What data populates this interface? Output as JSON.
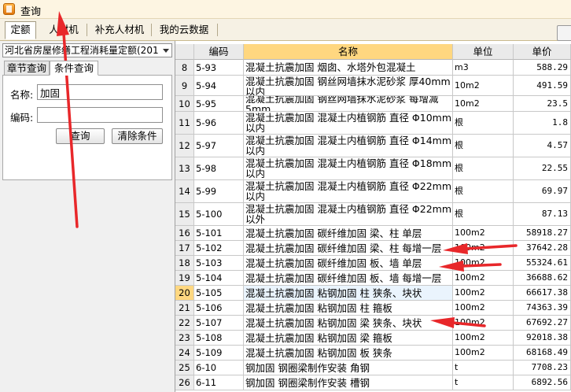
{
  "window": {
    "title": "查询"
  },
  "tabs": [
    {
      "label": "定额",
      "active": true
    },
    {
      "label": "人材机"
    },
    {
      "label": "补充人材机"
    },
    {
      "label": "我的云数据"
    }
  ],
  "left": {
    "quota_library": "河北省房屋修缮工程消耗量定额(201",
    "subtabs": [
      {
        "label": "章节查询"
      },
      {
        "label": "条件查询",
        "active": true
      }
    ],
    "form": {
      "name_label": "名称:",
      "name_value": "加固",
      "code_label": "编码:",
      "code_value": "",
      "search_button": "查询",
      "clear_button": "清除条件"
    }
  },
  "table": {
    "headers": [
      "",
      "编码",
      "名称",
      "单位",
      "单价"
    ],
    "rows": [
      {
        "idx": "8",
        "code": "5-93",
        "name": "混凝土抗震加固 烟囱、水塔外包混凝土",
        "unit": "m3",
        "price": "588.29"
      },
      {
        "idx": "9",
        "code": "5-94",
        "name": "混凝土抗震加固 钢丝网墙抹水泥砂浆 厚40mm以内",
        "unit": "10m2",
        "price": "491.59"
      },
      {
        "idx": "10",
        "code": "5-95",
        "name": "混凝土抗震加固 钢丝网墙抹水泥砂浆 每增减5mm",
        "unit": "10m2",
        "price": "23.5"
      },
      {
        "idx": "11",
        "code": "5-96",
        "name": "混凝土抗震加固 混凝土内植钢筋 直径 Φ10mm以内",
        "unit": "根",
        "price": "1.8"
      },
      {
        "idx": "12",
        "code": "5-97",
        "name": "混凝土抗震加固 混凝土内植钢筋 直径 Φ14mm以内",
        "unit": "根",
        "price": "4.57"
      },
      {
        "idx": "13",
        "code": "5-98",
        "name": "混凝土抗震加固 混凝土内植钢筋 直径 Φ18mm以内",
        "unit": "根",
        "price": "22.55"
      },
      {
        "idx": "14",
        "code": "5-99",
        "name": "混凝土抗震加固 混凝土内植钢筋 直径 Φ22mm以内",
        "unit": "根",
        "price": "69.97"
      },
      {
        "idx": "15",
        "code": "5-100",
        "name": "混凝土抗震加固 混凝土内植钢筋 直径 Φ22mm以外",
        "unit": "根",
        "price": "87.13"
      },
      {
        "idx": "16",
        "code": "5-101",
        "name": "混凝土抗震加固 碳纤维加固 梁、柱 单层",
        "unit": "100m2",
        "price": "58918.27"
      },
      {
        "idx": "17",
        "code": "5-102",
        "name": "混凝土抗震加固 碳纤维加固 梁、柱 每增一层",
        "unit": "100m2",
        "price": "37642.28"
      },
      {
        "idx": "18",
        "code": "5-103",
        "name": "混凝土抗震加固 碳纤维加固 板、墙 单层",
        "unit": "100m2",
        "price": "55324.61"
      },
      {
        "idx": "19",
        "code": "5-104",
        "name": "混凝土抗震加固 碳纤维加固 板、墙 每增一层",
        "unit": "100m2",
        "price": "36688.62"
      },
      {
        "idx": "20",
        "code": "5-105",
        "name": "混凝土抗震加固 粘钢加固 柱 狭条、块状",
        "unit": "100m2",
        "price": "66617.38",
        "active": true
      },
      {
        "idx": "21",
        "code": "5-106",
        "name": "混凝土抗震加固 粘钢加固 柱 箍板",
        "unit": "100m2",
        "price": "74363.39"
      },
      {
        "idx": "22",
        "code": "5-107",
        "name": "混凝土抗震加固 粘钢加固 梁 狭条、块状",
        "unit": "100m2",
        "price": "67692.27"
      },
      {
        "idx": "23",
        "code": "5-108",
        "name": "混凝土抗震加固 粘钢加固 梁 箍板",
        "unit": "100m2",
        "price": "92018.38"
      },
      {
        "idx": "24",
        "code": "5-109",
        "name": "混凝土抗震加固 粘钢加固 板 狭条",
        "unit": "100m2",
        "price": "68168.49"
      },
      {
        "idx": "25",
        "code": "6-10",
        "name": "钢加固 钢圈梁制作安装 角钢",
        "unit": "t",
        "price": "7708.23"
      },
      {
        "idx": "26",
        "code": "6-11",
        "name": "钢加固 钢圈梁制作安装 槽钢",
        "unit": "t",
        "price": "6892.56"
      }
    ]
  },
  "colors": {
    "annotation": "#e8272a",
    "selected_header": "#ffd780"
  }
}
